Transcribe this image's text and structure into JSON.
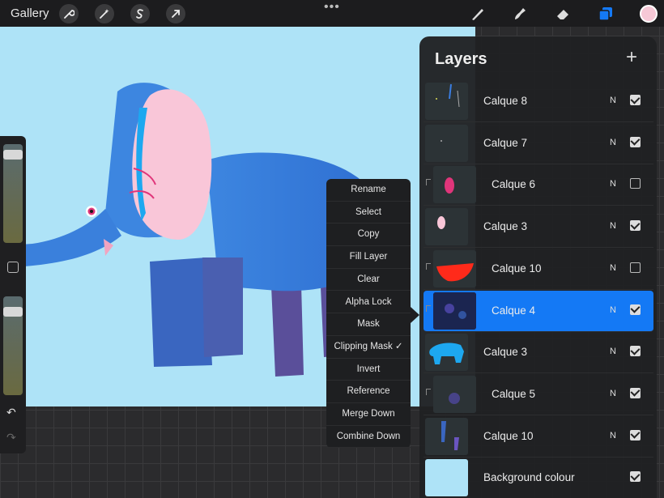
{
  "topbar": {
    "gallery_label": "Gallery",
    "tools_left": [
      "wrench-icon",
      "magic-wand-icon",
      "selection-s-icon",
      "transform-arrow-icon"
    ],
    "tools_right": [
      "brush-icon",
      "smudge-icon",
      "eraser-icon",
      "layers-icon"
    ],
    "more_label": "•••",
    "active_color": "#f6c8d6"
  },
  "sidebar": {
    "undo_label": "↶",
    "redo_label": "↷"
  },
  "layers": {
    "title": "Layers",
    "add_label": "+",
    "items": [
      {
        "name": "Calque 8",
        "blend": "N",
        "visible": true,
        "clipped": false,
        "selected": false
      },
      {
        "name": "Calque 7",
        "blend": "N",
        "visible": true,
        "clipped": false,
        "selected": false
      },
      {
        "name": "Calque 6",
        "blend": "N",
        "visible": false,
        "clipped": true,
        "selected": false
      },
      {
        "name": "Calque 3",
        "blend": "N",
        "visible": true,
        "clipped": false,
        "selected": false
      },
      {
        "name": "Calque 10",
        "blend": "N",
        "visible": false,
        "clipped": true,
        "selected": false
      },
      {
        "name": "Calque 4",
        "blend": "N",
        "visible": true,
        "clipped": true,
        "selected": true
      },
      {
        "name": "Calque 3",
        "blend": "N",
        "visible": true,
        "clipped": false,
        "selected": false
      },
      {
        "name": "Calque 5",
        "blend": "N",
        "visible": true,
        "clipped": true,
        "selected": false
      },
      {
        "name": "Calque 10",
        "blend": "N",
        "visible": true,
        "clipped": false,
        "selected": false
      },
      {
        "name": "Background colour",
        "blend": "",
        "visible": true,
        "clipped": false,
        "selected": false
      }
    ],
    "background_color": "#aee3f7",
    "accent_color": "#1479f5"
  },
  "context_menu": {
    "items": [
      "Rename",
      "Select",
      "Copy",
      "Fill Layer",
      "Clear",
      "Alpha Lock",
      "Mask",
      "Clipping Mask ✓",
      "Invert",
      "Reference",
      "Merge Down",
      "Combine Down"
    ]
  }
}
